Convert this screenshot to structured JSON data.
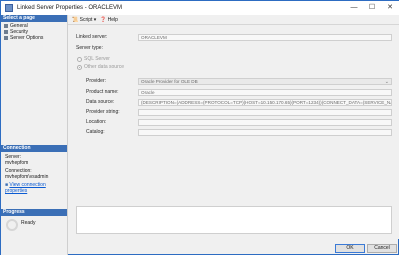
{
  "window": {
    "title": "Linked Server Properties - ORACLEVM",
    "minimize": "—",
    "maximize": "☐",
    "close": "✕"
  },
  "left": {
    "select_page_header": "Select a page",
    "pages": [
      "General",
      "Security",
      "Server Options"
    ],
    "connection_header": "Connection",
    "server_label": "Server:",
    "server_value": "mvhepfom",
    "connection_label": "Connection:",
    "connection_value": "mvhepfom\\vsadmin",
    "view_link": "View connection properties",
    "progress_header": "Progress",
    "ready": "Ready"
  },
  "toolbar": {
    "script": "Script",
    "help": "Help"
  },
  "form": {
    "linked_server_label": "Linked server:",
    "linked_server_value": "ORACLEVM",
    "server_type_label": "Server type:",
    "sql_server": "SQL Server",
    "other_source": "Other data source",
    "provider_label": "Provider:",
    "provider_value": "Oracle Provider for OLE DB",
    "product_name_label": "Product name:",
    "product_name_value": "Oracle",
    "data_source_label": "Data source:",
    "data_source_value": "(DESCRIPTION=(ADDRESS=(PROTOCOL=TCP)(HOST=10.150.170.65)(PORT=1234))(CONNECT_DATA=(SERVICE_NAME=xe)))",
    "provider_string_label": "Provider string:",
    "location_label": "Location:",
    "catalog_label": "Catalog:"
  },
  "buttons": {
    "ok": "OK",
    "cancel": "Cancel"
  }
}
